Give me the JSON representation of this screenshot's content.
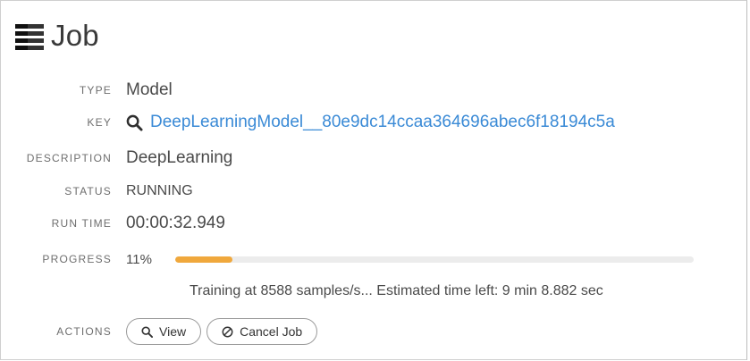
{
  "header": {
    "title": "Job",
    "icon": "list-icon"
  },
  "fields": {
    "type": {
      "label": "TYPE",
      "value": "Model"
    },
    "key": {
      "label": "KEY",
      "value": "DeepLearningModel__80e9dc14ccaa364696abec6f18194c5a",
      "icon": "search-icon"
    },
    "description": {
      "label": "DESCRIPTION",
      "value": "DeepLearning"
    },
    "status": {
      "label": "STATUS",
      "value": "RUNNING"
    },
    "run_time": {
      "label": "RUN TIME",
      "value": "00:00:32.949"
    },
    "progress": {
      "label": "PROGRESS",
      "percent_text": "11%",
      "fraction": 0.11,
      "message": "Training at 8588 samples/s... Estimated time left: 9 min 8.882 sec"
    }
  },
  "actions": {
    "label": "ACTIONS",
    "view_label": "View",
    "cancel_label": "Cancel Job"
  },
  "colors": {
    "link": "#3a8ad6",
    "progress_fill": "#f0a83c",
    "progress_track": "#ececec"
  }
}
